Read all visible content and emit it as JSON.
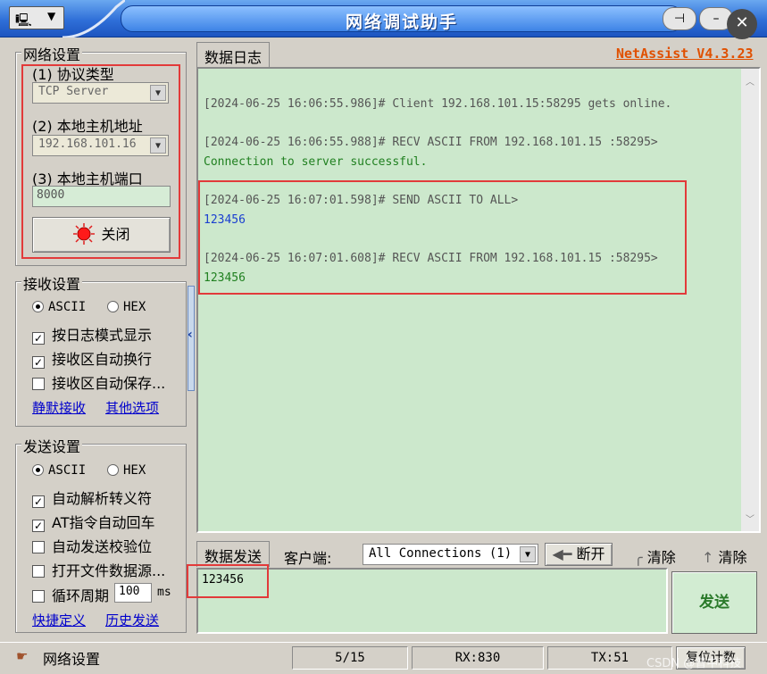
{
  "window": {
    "title": "网络调试助手",
    "pin_glyph": "⊣",
    "minimize_glyph": "–",
    "close_glyph": "✕",
    "sys_icon_glyph": "🖳",
    "sys_menu_glyph": "▼"
  },
  "net_settings": {
    "title": "网络设置",
    "protocol_label": "(1) 协议类型",
    "protocol_value": "TCP Server",
    "host_label": "(2) 本地主机地址",
    "host_value": "192.168.101.16",
    "port_label": "(3) 本地主机端口",
    "port_value": "8000",
    "close_button": "关闭"
  },
  "recv_settings": {
    "title": "接收设置",
    "opt_ascii": "ASCII",
    "opt_hex": "HEX",
    "check_log_mode": "按日志模式显示",
    "check_auto_wrap": "接收区自动换行",
    "check_auto_save": "接收区自动保存...",
    "link_silent": "静默接收",
    "link_other": "其他选项"
  },
  "send_settings": {
    "title": "发送设置",
    "opt_ascii": "ASCII",
    "opt_hex": "HEX",
    "check_escape": "自动解析转义符",
    "check_at_cr": "AT指令自动回车",
    "check_checksum": "自动发送校验位",
    "check_file": "打开文件数据源...",
    "check_loop": "循环周期",
    "loop_value": "100",
    "loop_unit": "ms",
    "link_shortcut": "快捷定义",
    "link_history": "历史发送"
  },
  "log_panel": {
    "tab": "数据日志",
    "brand": "NetAssist V4.3.23",
    "entries": [
      {
        "header": "[2024-06-25 16:06:55.986]# Client 192.168.101.15:58295 gets online.",
        "body": ""
      },
      {
        "header": "[2024-06-25 16:06:55.988]# RECV ASCII FROM 192.168.101.15 :58295>",
        "body": "Connection to server successful."
      },
      {
        "header": "[2024-06-25 16:07:01.598]# SEND ASCII TO ALL>",
        "body": "123456"
      },
      {
        "header": "[2024-06-25 16:07:01.608]# RECV ASCII FROM 192.168.101.15 :58295>",
        "body": "123456"
      }
    ],
    "colors": {
      "header": "#555555",
      "recv_body": "#208020",
      "send_body": "#1a3fd0"
    }
  },
  "send_bar": {
    "tab": "数据发送",
    "client_label": "客户端:",
    "client_value": "All Connections (1)",
    "disconnect": "断开",
    "clear1": "清除",
    "clear2": "清除",
    "send_text": "123456",
    "send_button": "发送"
  },
  "status": {
    "label": "网络设置",
    "page": "5/15",
    "rx": "RX:830",
    "tx": "TX:51",
    "reset": "复位计数",
    "watermark": "CSDN @普中科技"
  },
  "accent": {
    "highlight_box": "#e23a3a",
    "link": "#0000cc"
  }
}
